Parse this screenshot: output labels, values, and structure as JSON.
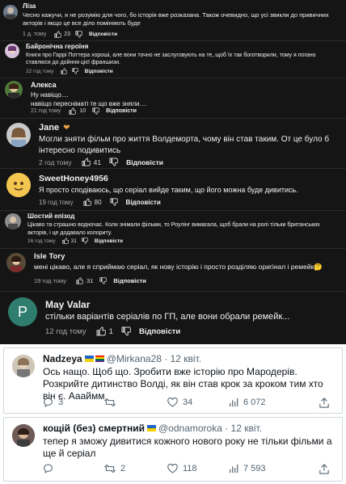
{
  "youtube_comments": [
    {
      "author": "Ліза",
      "text": "Чесно кажучи, я не розумію для чого, бо історія вже розказана. Також очевидно, що усі звикли до привичних акторів і якщо це все діло поміняють буде",
      "time": "1 д. тому",
      "likes": "23",
      "reply": "Відповісти"
    },
    {
      "author": "Байронічна героїня",
      "text": "Книги про Гаррі Поттера хороші, але вони точно не заслуговують на те, щоб їх так боготворили, тому я погано ставлюся до дойння цієї франшизи.",
      "time": "22 год тому",
      "likes": "",
      "reply": "Відповісти"
    },
    {
      "author": "Алекса",
      "text": "Ну навіщо....\nнавіщо пересніматі те що вже зняли....",
      "time": "21 год тому",
      "likes": "10",
      "reply": "Відповісти"
    },
    {
      "author": "Jane",
      "text": "Могли зняти фільм про життя Волдеморта, чому він став таким. От це було б інтересно подивитись",
      "time": "2 год тому",
      "likes": "41",
      "reply": "Відповісти"
    },
    {
      "author": "SweetHoney4956",
      "text": "Я просто сподіваюсь, що серіал вийде таким, що його можна буде дивитись.",
      "time": "19 год тому",
      "likes": "80",
      "reply": "Відповісти"
    },
    {
      "author": "Шостий епізод",
      "text": "Цікаво та страшно водночас. Коли знімали фільми, то Роулінг вимагала, щоб брали на ролі тільки британських акторів, і це додавало колориту.",
      "time": "16 год тому",
      "likes": "31",
      "reply": "Відповісти"
    },
    {
      "author": "Isle Tory",
      "text": "мені цікаво, але я сприймаю серіал, як нову історію і просто розділяю оригінал і ремейк🤔",
      "time": "19 год тому",
      "likes": "31",
      "reply": "Відповісти"
    },
    {
      "author": "May Valar",
      "avatar_letter": "P",
      "text": "стільки варіантів серіалів по ГП, але вони обрали ремейк...",
      "time": "12 год тому",
      "likes": "1",
      "reply": "Відповісти"
    }
  ],
  "tweets": [
    {
      "name": "Nadzeya",
      "handle": "@Mirkana28 · 12 квіт.",
      "text": "Ось нащо. Щоб що. Зробити вже історію про Мародерів. Розкрийте дитинство Волді, як він став крок за кроком тим хто він є. Аааймм",
      "replies": "3",
      "retweets": "",
      "likes": "34",
      "views": "6 072"
    },
    {
      "name": "кощій (без) смертний",
      "handle": "@odnamoroka · 12 квіт.",
      "text": "тепер я зможу дивитися кожного нового року не тільки фільми а ще й серіал",
      "replies": "",
      "retweets": "2",
      "likes": "118",
      "views": "7 593"
    }
  ],
  "colors": {
    "dark_bg": "#151515",
    "text_light": "#f1f1f1",
    "meta_gray": "#aaaaaa",
    "twitter_text": "#0f1419",
    "twitter_gray": "#536471",
    "may_avatar": "#2f7d6e"
  },
  "icons": [
    "thumb-up-icon",
    "thumb-down-icon",
    "reply-icon",
    "retweet-icon",
    "heart-icon",
    "views-icon",
    "share-icon"
  ]
}
